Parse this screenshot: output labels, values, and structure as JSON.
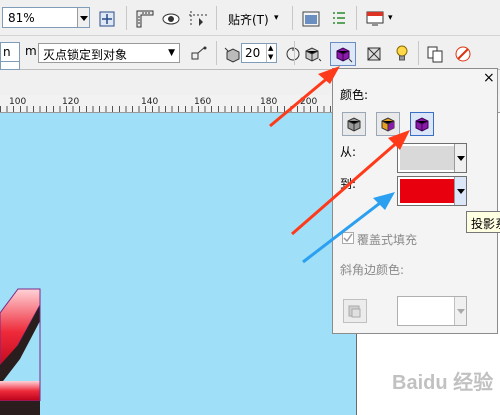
{
  "toolbar1": {
    "zoom_value": "81%",
    "snap_label": "贴齐(T)"
  },
  "toolbar2": {
    "left_partial": "n",
    "mm_label": "m",
    "vp_dropdown_value": "灭点锁定到对象",
    "depth_value": "20"
  },
  "ruler": {
    "ticks": [
      "100",
      "120",
      "140",
      "160",
      "180",
      "200"
    ]
  },
  "popup": {
    "color_heading": "颜色:",
    "from_label": "从:",
    "to_label": "到:",
    "overlay_fill_label": "覆盖式填充",
    "overlay_fill_checked": true,
    "bevel_color_label": "斜角边颜色:",
    "close_glyph": "×",
    "from_color": "#d9d9d9",
    "to_color": "#e8000e",
    "bevel_color": "#ffffff"
  },
  "tooltip": {
    "text": "投影系"
  },
  "colors": {
    "canvas": "#9fdff8",
    "accent_red_arrow": "#ff3a1a",
    "accent_blue_arrow": "#2b9ff0"
  },
  "watermark": {
    "text": "Baidu 经验"
  }
}
